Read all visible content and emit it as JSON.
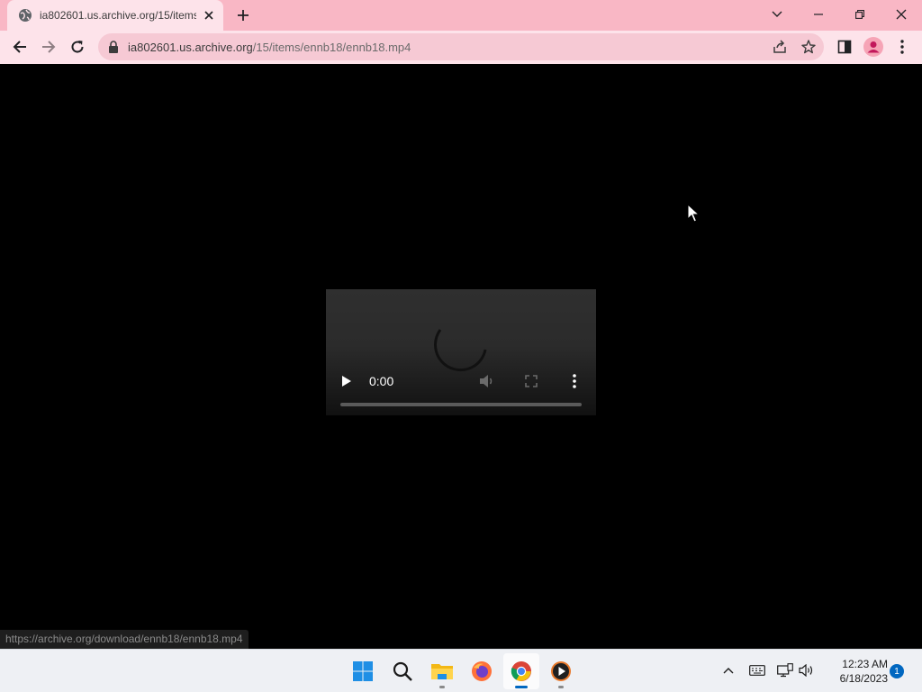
{
  "browser": {
    "tab": {
      "title": "ia802601.us.archive.org/15/items/ennb18/ennb18.mp4",
      "favicon": "globe-icon"
    },
    "url": {
      "host": "ia802601.us.archive.org",
      "path": "/15/items/ennb18/ennb18.mp4"
    },
    "status_url": "https://archive.org/download/ennb18/ennb18.mp4",
    "colors": {
      "frame": "#f9b7c5",
      "toolbar": "#fde3ea"
    }
  },
  "video_player": {
    "current_time": "0:00",
    "progress": 0,
    "state": "loading"
  },
  "taskbar": {
    "apps": [
      "start-icon",
      "search-icon",
      "file-explorer-icon",
      "firefox-icon",
      "chrome-icon",
      "media-player-icon"
    ],
    "clock": {
      "time": "12:23 AM",
      "date": "6/18/2023"
    },
    "notification_count": "1"
  }
}
